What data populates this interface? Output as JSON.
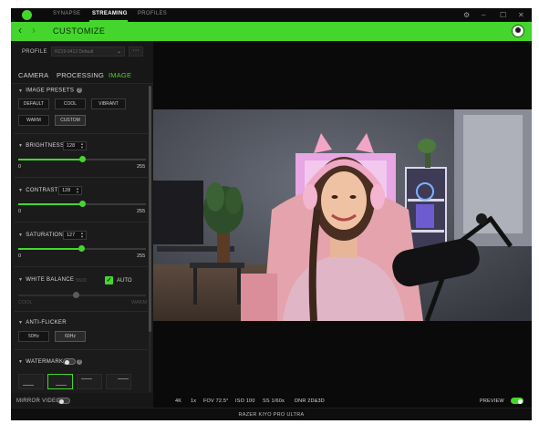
{
  "titlebar": {
    "nav": [
      "SYNAPSE",
      "STREAMING",
      "PROFILES"
    ],
    "active_nav": "STREAMING",
    "settings_icon": "gear-icon",
    "minimize": "–",
    "maximize": "☐",
    "close": "✕"
  },
  "header": {
    "back": "‹",
    "forward": "›",
    "title": "CUSTOMIZE",
    "avatar_icon": "user-avatar-icon"
  },
  "profile": {
    "label": "PROFILE",
    "value": "RZ19-0412 Default",
    "more": "···"
  },
  "tabs": [
    "CAMERA",
    "PROCESSING",
    "IMAGE"
  ],
  "active_tab": "IMAGE",
  "image_presets": {
    "title": "IMAGE PRESETS",
    "buttons": [
      "DEFAULT",
      "COOL",
      "VIBRANT",
      "WARM",
      "CUSTOM"
    ],
    "selected": "CUSTOM"
  },
  "brightness": {
    "title": "BRIGHTNESS",
    "value": "128",
    "min": "0",
    "max": "255",
    "level": 0.502
  },
  "contrast": {
    "title": "CONTRAST",
    "value": "128",
    "min": "0",
    "max": "255",
    "level": 0.502
  },
  "saturation": {
    "title": "SATURATION",
    "value": "127",
    "min": "0",
    "max": "255",
    "level": 0.498
  },
  "white_balance": {
    "title": "WHITE BALANCE",
    "value": "5600",
    "auto_label": "AUTO",
    "auto_checked": true,
    "min_label": "COOL",
    "max_label": "WARM",
    "level": 0.45
  },
  "anti_flicker": {
    "title": "ANTI-FLICKER",
    "options": [
      "50Hz",
      "60Hz"
    ],
    "selected": "60Hz"
  },
  "watermark": {
    "title": "WATERMARK",
    "enabled": false
  },
  "mirror_video": {
    "label": "MIRROR VIDEO",
    "enabled": false
  },
  "preview_stats": [
    "4K",
    "1x",
    "FOV 72.5°",
    "ISO 100",
    "SS 1/60s",
    "DNR 2D&3D"
  ],
  "preview": {
    "label": "PREVIEW",
    "enabled": true
  },
  "footer": {
    "device": "RAZER KIYO PRO ULTRA"
  },
  "colors": {
    "accent": "#44d62c",
    "panel": "#171717",
    "background": "#111111"
  }
}
